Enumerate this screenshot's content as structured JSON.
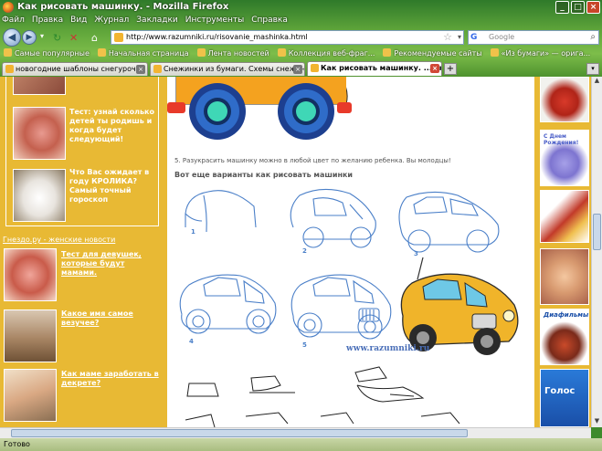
{
  "window": {
    "title": "Как рисовать машинку. - Mozilla Firefox",
    "controls": [
      "_",
      "□",
      "×"
    ]
  },
  "menu": [
    "Файл",
    "Правка",
    "Вид",
    "Журнал",
    "Закладки",
    "Инструменты",
    "Справка"
  ],
  "nav": {
    "url": "http://www.razumniki.ru/risovanie_mashinka.html",
    "search_placeholder": "Google"
  },
  "bookmarks": [
    "Самые популярные",
    "Начальная страница",
    "Лента новостей",
    "Коллекция веб-фраг...",
    "Рекомендуемые сайты",
    "«Из бумаги» — орига..."
  ],
  "tabs": [
    {
      "label": "новогодние шаблоны снегурочки из ...",
      "active": false
    },
    {
      "label": "Снежинки из бумаги. Схемы снежинок...",
      "active": false
    },
    {
      "label": "Как рисовать машинку. ...жною ё...",
      "active": true
    }
  ],
  "left": {
    "teaser1": "Тест: узнай сколько детей ты родишь и когда будет следующий!",
    "teaser2": "Что Вас ожидает в году КРОЛИКА? Самый точный гороскоп",
    "gnezdo": "Гнездо.ру - женские новости",
    "news1": "Тест для девушек, которые будут мамами.",
    "news2": "Какое имя самое везучее?",
    "news3": "Как маме заработать в декрете?"
  },
  "center": {
    "step5": "5. Разукрасить машинку можно в любой цвет по желанию ребенка. Вы молодцы!",
    "variants_heading": "Вот еще варианты как рисовать машинки",
    "step_numbers": [
      "1",
      "2",
      "3",
      "4",
      "5"
    ],
    "watermark": "www.razumniki.ru"
  },
  "right": {
    "card1": "С Днем Рождения!",
    "card2": "Диафильмы",
    "card3": "Голос"
  },
  "status": "Готово",
  "colors": {
    "sidebar": "#e8b934",
    "link_text": "#ffffff",
    "car_body": "#f4a21f",
    "wheel": "#2f6cc9",
    "hub": "#3fd7b6",
    "sketch": "#4a7fc8"
  }
}
